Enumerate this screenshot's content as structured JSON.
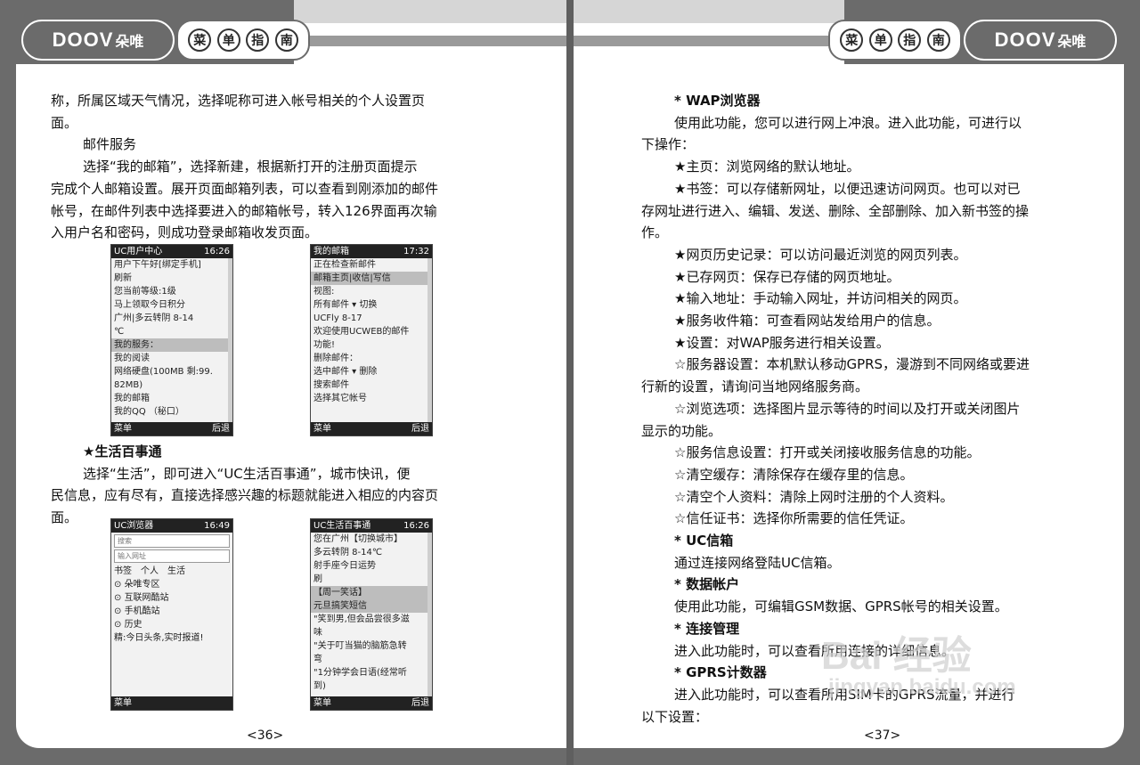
{
  "header": {
    "left_logo": {
      "brand": "DOOV",
      "cn": "朵唯"
    },
    "right_logo": {
      "brand": "DOOV",
      "cn": "朵唯"
    },
    "menu_chars": [
      "菜",
      "单",
      "指",
      "南"
    ]
  },
  "left": {
    "lines": [
      "称，所属区域天气情况，选择呢称可进入帐号相关的个人设置页",
      "面。",
      "邮件服务",
      "选择“我的邮箱”，选择新建，根据新打开的注册页面提示",
      "完成个人邮箱设置。展开页面邮箱列表，可以查看到刚添加的邮件",
      "帐号，在邮件列表中选择要进入的邮箱帐号，转入126界面再次输",
      "入用户名和密码，则成功登录邮箱收发页面。"
    ],
    "life_heading": "★生活百事通",
    "life_lines": [
      "选择“生活”，即可进入“UC生活百事通”，城市快讯，便",
      "民信息，应有尽有，直接选择感兴趣的标题就能进入相应的内容页",
      "面。"
    ],
    "page_number": "<36>"
  },
  "screens": {
    "uc_user": {
      "title": "UC用户中心",
      "time": "16:26",
      "lines": [
        "用户下午好[绑定手机]",
        "刷新",
        "您当前等级:1级",
        "马上领取今日积分",
        "广州|多云转阴 8-14",
        "℃",
        "我的服务：",
        "我的阅读",
        "网络硬盘(100MB 剩:99.",
        "82MB)",
        "我的邮箱",
        "我的QQ （秘口）"
      ],
      "left_soft": "菜单",
      "right_soft": "后退"
    },
    "mailbox": {
      "title": "我的邮箱",
      "time": "17:32",
      "lines": [
        "正在检查新邮件",
        "邮箱主页|收信|写信",
        "视图:",
        "所有邮件 ▾ 切换",
        "UCFly 8-17",
        "欢迎使用UCWEB的邮件",
        "功能!",
        "删除邮件：",
        "选中邮件 ▾ 删除",
        "搜索邮件",
        "选择其它帐号"
      ],
      "left_soft": "菜单",
      "right_soft": "后退"
    },
    "uc_browser": {
      "title": "UC浏览器",
      "time": "16:49",
      "search_placeholder": "搜索",
      "url_placeholder": "输入网址",
      "tabs": [
        "书签",
        "个人",
        "生活"
      ],
      "items": [
        "朵唯专区",
        "互联网酷站",
        "手机酷站",
        "历史"
      ],
      "news": "精:今日头条,实时报道!",
      "left_soft": "菜单"
    },
    "uc_life": {
      "title": "UC生活百事通",
      "time": "16:26",
      "lines": [
        "您在广州【切换城市】",
        "多云转阴 8-14℃",
        "射手座今日运势",
        "刷",
        "【周一笑话】",
        "元旦搞笑短信",
        "\"笑到男,但会品尝很多滋",
        "味",
        "\"关于叮当猫的脑筋急转",
        "弯",
        "\"1分钟学会日语(经常听",
        "到)"
      ],
      "left_soft": "菜单",
      "right_soft": "后退"
    }
  },
  "right": {
    "items": [
      {
        "text": "* WAP浏览器",
        "bold": true,
        "indent": 1
      },
      {
        "text": "使用此功能，您可以进行网上冲浪。进入此功能，可进行以",
        "indent": 1
      },
      {
        "text": "下操作：",
        "indent": 0
      },
      {
        "text": "★主页：浏览网络的默认地址。",
        "indent": 1
      },
      {
        "text": "★书签：可以存储新网址，以便迅速访问网页。也可以对已",
        "indent": 1
      },
      {
        "text": "存网址进行进入、编辑、发送、删除、全部删除、加入新书签的操",
        "indent": 0
      },
      {
        "text": "作。",
        "indent": 0
      },
      {
        "text": "★网页历史记录：可以访问最近浏览的网页列表。",
        "indent": 1
      },
      {
        "text": "★已存网页：保存已存储的网页地址。",
        "indent": 1
      },
      {
        "text": "★输入地址：手动输入网址，并访问相关的网页。",
        "indent": 1
      },
      {
        "text": "★服务收件箱：可查看网站发给用户的信息。",
        "indent": 1
      },
      {
        "text": "★设置：对WAP服务进行相关设置。",
        "indent": 1
      },
      {
        "text": "☆服务器设置：本机默认移动GPRS，漫游到不同网络或要进",
        "indent": 1
      },
      {
        "text": "行新的设置，请询问当地网络服务商。",
        "indent": 0
      },
      {
        "text": "☆浏览选项：选择图片显示等待的时间以及打开或关闭图片",
        "indent": 1
      },
      {
        "text": "显示的功能。",
        "indent": 0
      },
      {
        "text": "☆服务信息设置：打开或关闭接收服务信息的功能。",
        "indent": 1
      },
      {
        "text": "☆清空缓存：清除保存在缓存里的信息。",
        "indent": 1
      },
      {
        "text": "☆清空个人资料：清除上网时注册的个人资料。",
        "indent": 1
      },
      {
        "text": "☆信任证书：选择你所需要的信任凭证。",
        "indent": 1
      },
      {
        "text": "* UC信箱",
        "bold": true,
        "indent": 1
      },
      {
        "text": "通过连接网络登陆UC信箱。",
        "indent": 1
      },
      {
        "text": "* 数据帐户",
        "bold": true,
        "indent": 1
      },
      {
        "text": "使用此功能，可编辑GSM数据、GPRS帐号的相关设置。",
        "indent": 1
      },
      {
        "text": "* 连接管理",
        "bold": true,
        "indent": 1
      },
      {
        "text": "进入此功能时，可以查看所用连接的详细信息。",
        "indent": 1
      },
      {
        "text": "* GPRS计数器",
        "bold": true,
        "indent": 1
      },
      {
        "text": "进入此功能时，可以查看所用SIM卡的GPRS流量，并进行",
        "indent": 1
      },
      {
        "text": "以下设置：",
        "indent": 0
      }
    ],
    "page_number": "<37>"
  },
  "watermark": {
    "main": "Bai 经验",
    "sub": "jingyan.baidu.com"
  }
}
